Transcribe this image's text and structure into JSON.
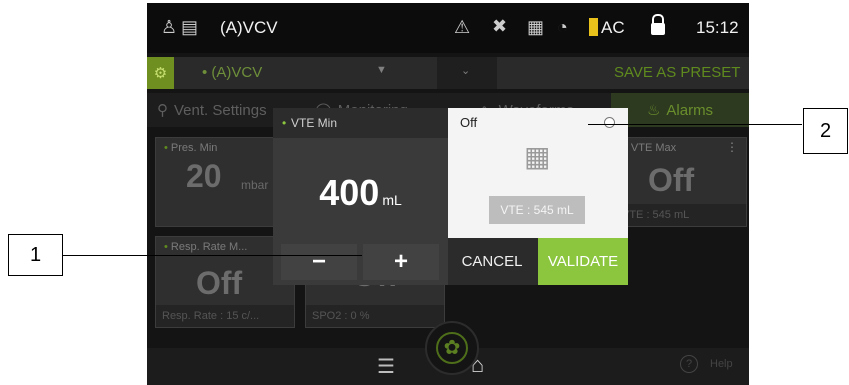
{
  "status": {
    "mode": "(A)VCV",
    "power_label": "AC",
    "time": "15:12"
  },
  "preset_bar": {
    "mode_selected": "• (A)VCV",
    "save_label": "SAVE AS PRESET"
  },
  "tabs": [
    {
      "label": "Vent. Settings"
    },
    {
      "label": "Monitoring"
    },
    {
      "label": "Waveforms"
    },
    {
      "label": "Alarms"
    }
  ],
  "cards": {
    "pres_min": {
      "title": "Pres. Min",
      "value": "20",
      "unit": "mbar"
    },
    "vte_max": {
      "title": "VTE Max",
      "value": "Off",
      "footer": "VTE : 545 mL"
    },
    "resp_rate": {
      "title": "Resp. Rate M...",
      "value": "Off",
      "footer": "Resp. Rate : 15 c/..."
    },
    "spo2": {
      "value": "Off",
      "footer": "SPO2 : 0 %"
    }
  },
  "bottom_bar": {
    "help_label": "Help"
  },
  "dialog": {
    "title": "VTE Min",
    "value": "400",
    "unit": "mL",
    "minus_label": "−",
    "plus_label": "+",
    "off_label": "Off",
    "current_chip": "VTE : 545 mL",
    "cancel_label": "CANCEL",
    "validate_label": "VALIDATE"
  },
  "callouts": {
    "one": "1",
    "two": "2"
  },
  "colors": {
    "accent_green": "#8cc63f",
    "dark_bg": "#141414"
  }
}
